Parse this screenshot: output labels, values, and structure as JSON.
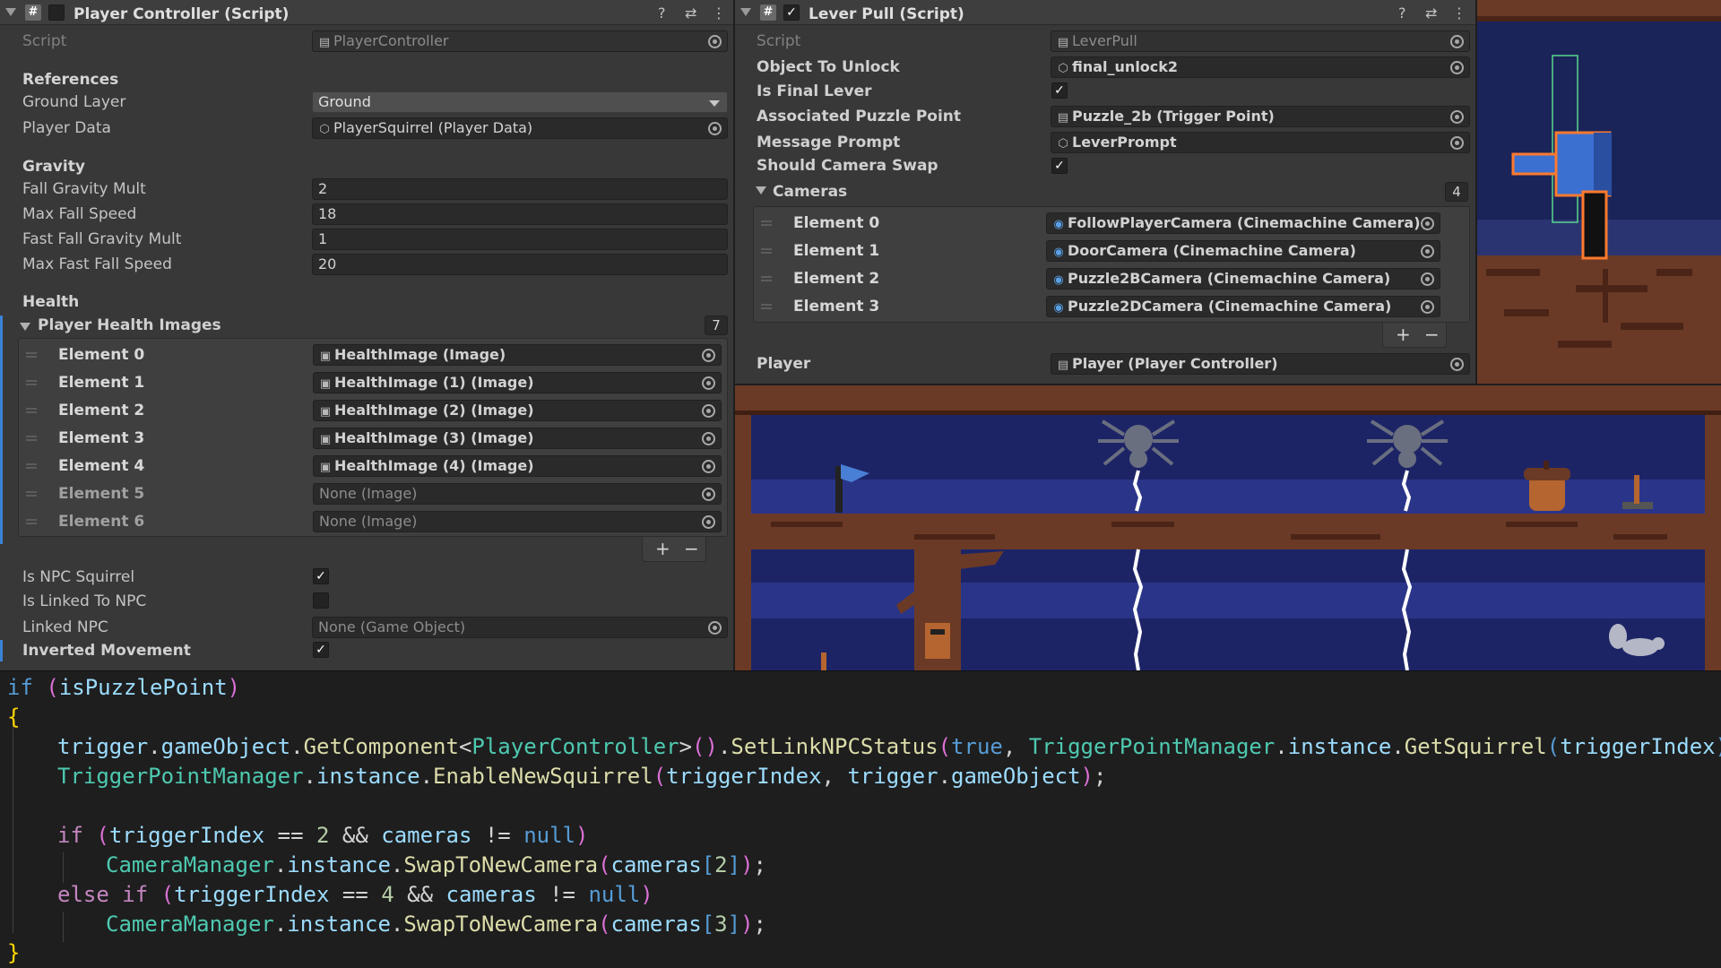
{
  "player_controller": {
    "title": "Player Controller (Script)",
    "script_label": "Script",
    "script_value": "PlayerController",
    "references_header": "References",
    "ground_layer_label": "Ground Layer",
    "ground_layer_value": "Ground",
    "player_data_label": "Player Data",
    "player_data_value": "PlayerSquirrel (Player Data)",
    "gravity_header": "Gravity",
    "fall_gravity_mult_label": "Fall Gravity Mult",
    "fall_gravity_mult_value": "2",
    "max_fall_speed_label": "Max Fall Speed",
    "max_fall_speed_value": "18",
    "fast_fall_gravity_mult_label": "Fast Fall Gravity Mult",
    "fast_fall_gravity_mult_value": "1",
    "max_fast_fall_speed_label": "Max Fast Fall Speed",
    "max_fast_fall_speed_value": "20",
    "health_header": "Health",
    "health_images_label": "Player Health Images",
    "health_images_count": "7",
    "health_elements": [
      {
        "label": "Element 0",
        "value": "HealthImage (Image)"
      },
      {
        "label": "Element 1",
        "value": "HealthImage (1) (Image)"
      },
      {
        "label": "Element 2",
        "value": "HealthImage (2) (Image)"
      },
      {
        "label": "Element 3",
        "value": "HealthImage (3) (Image)"
      },
      {
        "label": "Element 4",
        "value": "HealthImage (4) (Image)"
      },
      {
        "label": "Element 5",
        "value": "None (Image)"
      },
      {
        "label": "Element 6",
        "value": "None (Image)"
      }
    ],
    "plus": "+",
    "minus": "−",
    "is_npc_squirrel_label": "Is NPC Squirrel",
    "is_npc_squirrel": true,
    "is_linked_to_npc_label": "Is Linked To NPC",
    "is_linked_to_npc": false,
    "linked_npc_label": "Linked NPC",
    "linked_npc_value": "None (Game Object)",
    "inverted_movement_label": "Inverted Movement",
    "inverted_movement": true
  },
  "lever_pull": {
    "title": "Lever Pull (Script)",
    "enabled": true,
    "script_label": "Script",
    "script_value": "LeverPull",
    "object_to_unlock_label": "Object To Unlock",
    "object_to_unlock_value": "final_unlock2",
    "is_final_lever_label": "Is Final Lever",
    "is_final_lever": true,
    "associated_puzzle_point_label": "Associated Puzzle Point",
    "associated_puzzle_point_value": "Puzzle_2b (Trigger Point)",
    "message_prompt_label": "Message Prompt",
    "message_prompt_value": "LeverPrompt",
    "should_camera_swap_label": "Should Camera Swap",
    "should_camera_swap": true,
    "cameras_label": "Cameras",
    "cameras_count": "4",
    "camera_elements": [
      {
        "label": "Element 0",
        "value": "FollowPlayerCamera (Cinemachine Camera)"
      },
      {
        "label": "Element 1",
        "value": "DoorCamera (Cinemachine Camera)"
      },
      {
        "label": "Element 2",
        "value": "Puzzle2BCamera (Cinemachine Camera)"
      },
      {
        "label": "Element 3",
        "value": "Puzzle2DCamera (Cinemachine Camera)"
      }
    ],
    "plus": "+",
    "minus": "−",
    "player_label": "Player",
    "player_value": "Player (Player Controller)"
  },
  "icons": {
    "check": "✓",
    "help": "?",
    "settings": "⇄",
    "more": "⋮",
    "hash": "#"
  },
  "code": {
    "line1": [
      "if",
      " (",
      "isPuzzlePoint",
      ")"
    ],
    "line2": "{",
    "line3": [
      "trigger",
      ".",
      "gameObject",
      ".",
      "GetComponent",
      "<",
      "PlayerController",
      ">",
      "()",
      ".",
      "SetLinkNPCStatus",
      "(",
      "true",
      ", ",
      "TriggerPointManager",
      ".",
      "instance",
      ".",
      "GetSquirrel",
      "(",
      "triggerIndex",
      ")",
      ")",
      ";"
    ],
    "line4": [
      "TriggerPointManager",
      ".",
      "instance",
      ".",
      "EnableNewSquirrel",
      "(",
      "triggerIndex",
      ", ",
      "trigger",
      ".",
      "gameObject",
      ")",
      ";"
    ],
    "line6": [
      "if",
      " (",
      "triggerIndex",
      " == ",
      "2",
      " && ",
      "cameras",
      " != ",
      "null",
      ")"
    ],
    "line7": [
      "CameraManager",
      ".",
      "instance",
      ".",
      "SwapToNewCamera",
      "(",
      "cameras",
      "[",
      "2",
      "]",
      ")",
      ";"
    ],
    "line8": [
      "else",
      " ",
      "if",
      " (",
      "triggerIndex",
      " == ",
      "4",
      " && ",
      "cameras",
      " != ",
      "null",
      ")"
    ],
    "line9": [
      "CameraManager",
      ".",
      "instance",
      ".",
      "SwapToNewCamera",
      "(",
      "cameras",
      "[",
      "3",
      "]",
      ")",
      ";"
    ],
    "line10": "}"
  }
}
